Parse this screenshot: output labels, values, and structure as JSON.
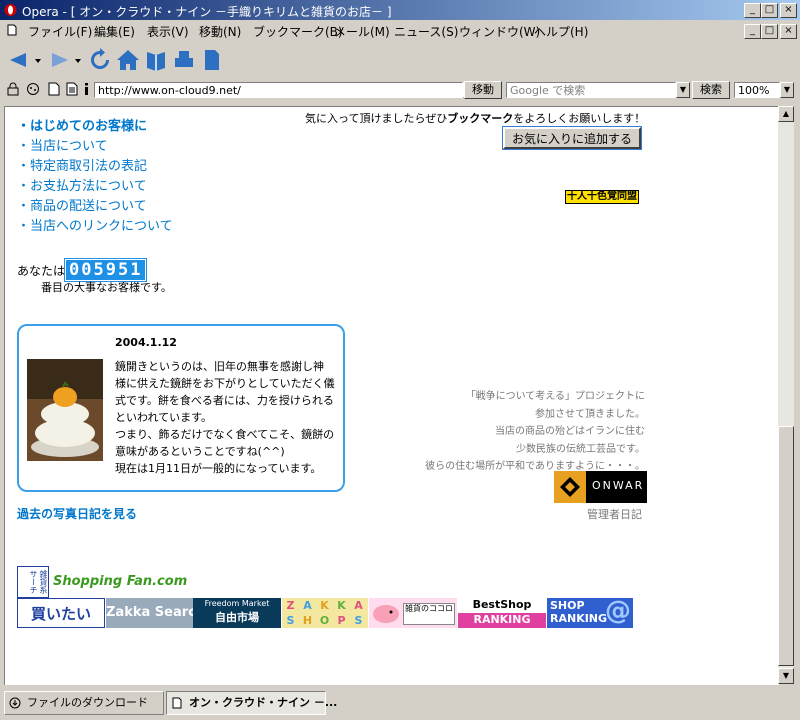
{
  "window": {
    "title": "Opera - [ オン・クラウド・ナイン －手織りキリムと雑貨のお店－ ]",
    "min_glyph": "_",
    "max_glyph": "□",
    "close_glyph": "×"
  },
  "menubar": {
    "items": [
      "ファイル(F)",
      "編集(E)",
      "表示(V)",
      "移動(N)",
      "ブックマーク(B)",
      "メール(M)",
      "ニュース(S)",
      "ウィンドウ(W)",
      "ヘルプ(H)"
    ]
  },
  "address": {
    "url": "http://www.on-cloud9.net/",
    "go_label": "移動",
    "search_placeholder": "Google で検索",
    "search_label": "検索",
    "zoom": "100%"
  },
  "page": {
    "nav_links": [
      "・はじめてのお客様に",
      "・当店について",
      "・特定商取引法の表記",
      "・お支払方法について",
      "・商品の配送について",
      "・当店へのリンクについて"
    ],
    "bookmark_notice_pre": "気に入って頂けましたらぜひ",
    "bookmark_notice_bold": "ブックマーク",
    "bookmark_notice_post": "をよろしくお願いします！",
    "add_favorite_label": "お気に入りに追加する",
    "alliance_badge": "十人十色覚同盟",
    "visitor_prefix": "あなたは",
    "visitor_count": "005951",
    "visitor_suffix": "番目の大事なお客様です。",
    "diary": {
      "date": "2004.1.12",
      "text_lines": [
        "鏡開きというのは、旧年の無事を感謝し神",
        "様に供えた鏡餅をお下がりとしていただく儀",
        "式です。餅を食べる者には、力を授けられる",
        "といわれています。",
        "つまり、飾るだけでなく食べてこそ、鏡餅の",
        "意味があるということですね(^^)",
        "現在は1月11日が一般的になっています。"
      ]
    },
    "past_diary_link": "過去の写真日記を見る",
    "war_project_lines": [
      "「戦争について考える」プロジェクトに",
      "参加させて頂きました。",
      "当店の商品の殆どはイランに住む",
      "少数民族の伝統工芸品です。",
      "彼らの住む場所が平和でありますように・・・。"
    ],
    "onwar_label": "ONWAR",
    "admin_diary_link": "管理者日記",
    "banners": {
      "zakka_search_small": "雑貨系サーチ",
      "shopping_fan": "Shopping Fan.com",
      "kaiitai": "買いたい",
      "zakka_search": "Zakka Search",
      "freedom_market_top": "Freedom Market",
      "freedom_market_bottom": "自由市場",
      "zakka_shops": [
        "Z",
        "A",
        "K",
        "K",
        "A",
        "S",
        "H",
        "O",
        "P",
        "S"
      ],
      "zakka_kokoro": "雑貨のココロ",
      "bestshop_top": "BestShop",
      "bestshop_bottom": "RANKING",
      "shop_ranking_top": "SHOP",
      "shop_ranking_bottom": "RANKING",
      "shop_ranking_at": "@"
    }
  },
  "statusbar": {
    "tab1": "ファイルのダウンロード",
    "tab2": "オン・クラウド・ナイン －..."
  },
  "colors": {
    "link": "#0077cc",
    "counter_bg": "#1e90e6",
    "diary_border": "#3aa0e8",
    "title_gradient_start": "#0a246a",
    "title_gradient_end": "#a6caf0"
  }
}
